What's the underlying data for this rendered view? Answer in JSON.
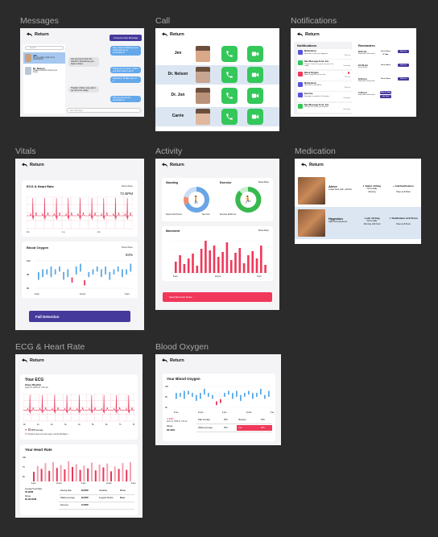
{
  "sections": {
    "messages": "Messages",
    "call": "Call",
    "notifications": "Notifications",
    "vitals": "Vitals",
    "activity": "Activity",
    "medication": "Medication",
    "ecg": "ECG & Heart Rate",
    "blood_oxygen": "Blood Oxygen"
  },
  "return_label": "Return",
  "messages": {
    "compose_label": "Compose New Message",
    "search_placeholder": "Search",
    "contacts": [
      {
        "name": "Jen",
        "preview": "Are you able to pick up my prescription?"
      },
      {
        "name": "Dr. Nelson",
        "preview": "I'll take a look at it and let you know."
      }
    ],
    "bubbles": [
      "Hey, I was wondering if you could pick up my prescription?",
      "Are you home from the doctors? Sometimes you leave it there.",
      "Thank you so much. I didn't see them when I got it.",
      "Awesome, I'll take care of it.",
      "Thanks! I think I can pick it up now if it's ready.",
      "Did you pick up the prescription?"
    ],
    "input_placeholder": "New Message"
  },
  "call": {
    "contacts": [
      "Jen",
      "Dr. Nelson",
      "Dr. Jon",
      "Carrie"
    ]
  },
  "notifications": {
    "heading": "Notifications",
    "reminders_heading": "Reminders",
    "items": [
      {
        "title": "Medications",
        "body": "Reminder to take your Hygroton",
        "time": "8:00 am"
      },
      {
        "title": "New Message From: Jen",
        "body": "Thanks! I think I can pick it up now if it's ready.",
        "time": "Yesterday"
      },
      {
        "title": "Blood Oxygen",
        "body": "Blood Oxygen levels are low",
        "time": "9:00 am"
      },
      {
        "title": "Medications",
        "body": "Reminder to take Aleve",
        "time": "8:00 am"
      },
      {
        "title": "Exercise",
        "body": "Reminder to stand for 10 minutes",
        "time": "Yesterday"
      },
      {
        "title": "New Message From: Jen",
        "body": "Did you pick up the prescription?",
        "time": "Yesterday"
      }
    ],
    "reminders": [
      {
        "time": "8:00 am",
        "title": "Medication Reminder",
        "action": "Go to Store & Take",
        "action2": "Mark as Complete"
      },
      {
        "time": "10:00 am",
        "title": "Drink Water",
        "action": "Go to Store",
        "action2": "Mark as Complete"
      },
      {
        "time": "6:00 pm",
        "title": "Medication Reminder",
        "action": "Go to Store",
        "action2": "Mark as Complete"
      },
      {
        "time": "7:30 pm",
        "title": "Medication Reminder",
        "action": "Mark & Take",
        "action2": "Set Task"
      }
    ]
  },
  "vitals": {
    "ecg_title": "ECG & Heart Rate",
    "show_more": "Show More",
    "bpm": "72 BPM",
    "ecg_ticks": [
      "0 s",
      "1 s",
      "2 s",
      "3 s"
    ],
    "bo_title": "Blood Oxygen",
    "bo_value": "94%",
    "bo_yticks": [
      "100",
      "95",
      "90"
    ],
    "bo_xticks": [
      "6 am",
      "12 pm",
      "6 pm"
    ],
    "fall_label": "Fall Detection"
  },
  "activity": {
    "standing": "Standing",
    "exercise": "Exercise",
    "show_more": "Show More",
    "stand_left": "Stood 12/12 Hours",
    "stand_right": "Sat 4 hrs",
    "exercise_left": "Exercise 30/30 min",
    "movement": "Movement",
    "move_xticks": [
      "6 am",
      "12 pm",
      "6 pm"
    ],
    "button": "Stand Reminder Notes"
  },
  "medication": {
    "items": [
      {
        "name": "Aleve",
        "desc": "Lower back pain, arthritis",
        "dose": "1 Tablet, 220mg",
        "freq": "Once Daily",
        "when": "Morning",
        "action": "+ Add Notification",
        "action_sub": "Taken at 8:30am"
      },
      {
        "name": "Hygroton",
        "desc": "High blood pressure",
        "dose": "1 pill, 12.5mg",
        "freq": "Once Daily",
        "when": "Morning with food",
        "action": "✓ Notification at 8:30 am",
        "action_sub": "Taken at 8:31am"
      }
    ]
  },
  "ecg": {
    "title": "Your ECG",
    "subtitle": "Sinus Rhythm",
    "date": "April 15, 2025 at 7:40 am",
    "bpm": "72",
    "bpm_unit": "BPM Average",
    "note": "This ECG does not show signs of Atrial Fibrillation.",
    "hr_title": "Your Heart Rate",
    "hr_xticks": [
      "6 am",
      "12 pm",
      "6 pm",
      "12 am",
      "6 am"
    ],
    "stats_left": [
      {
        "label": "Average Heart Rate",
        "value": "78 BPM"
      },
      {
        "label": "Range",
        "value": "60-98 BPM"
      }
    ],
    "stats": [
      [
        "Resting Rate",
        "68 BPM",
        "Variability",
        "45 ms"
      ],
      [
        "Walking Average",
        "98 BPM",
        "Irregular Rhythm",
        "None"
      ],
      [
        "Recovery",
        "32 BPM",
        "",
        ""
      ]
    ]
  },
  "oxygen": {
    "title": "Your Blood Oxygen",
    "yticks": [
      "100",
      "95",
      "90"
    ],
    "xticks": [
      "6 am",
      "12 pm",
      "6 pm",
      "12 am",
      "6 am"
    ],
    "latest": "94%",
    "latest_date": "April 15, 2025 at 7:40 am",
    "range_label": "Range",
    "range": "90-99%",
    "stats": [
      [
        "Daily Average",
        "96%",
        "Sleeping",
        "93%"
      ],
      [
        "Walking Average",
        "95%",
        "Low",
        "90%"
      ]
    ]
  },
  "colors": {
    "accent": "#453a9b",
    "green": "#34c759",
    "red": "#f0385a",
    "blue": "#4aa3e8"
  }
}
